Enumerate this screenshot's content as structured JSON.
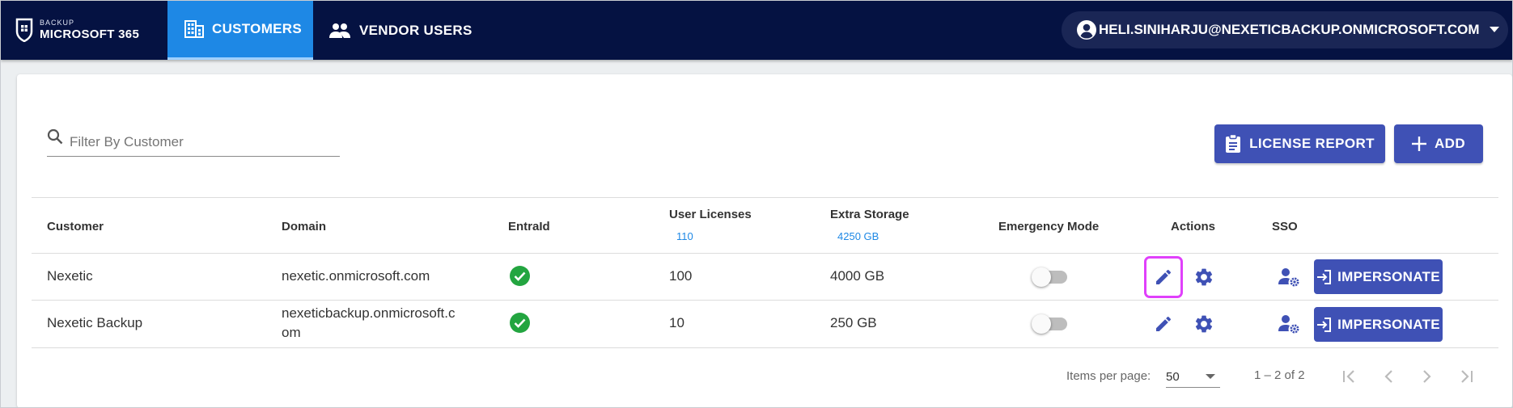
{
  "header": {
    "logo": {
      "small": "BACKUP",
      "big": "MICROSOFT 365"
    },
    "tabs": [
      {
        "label": "CUSTOMERS",
        "icon": "building-icon",
        "active": true
      },
      {
        "label": "VENDOR USERS",
        "icon": "people-icon",
        "active": false
      }
    ],
    "user_email": "HELI.SINIHARJU@NEXETICBACKUP.ONMICROSOFT.COM"
  },
  "toolbar": {
    "filter_placeholder": "Filter By Customer",
    "license_report_label": "LICENSE REPORT",
    "add_label": "ADD"
  },
  "table": {
    "columns": {
      "customer": "Customer",
      "domain": "Domain",
      "entraid": "EntraId",
      "user_licenses": "User Licenses",
      "user_licenses_total": "110",
      "extra_storage": "Extra Storage",
      "extra_storage_total": "4250 GB",
      "emergency_mode": "Emergency Mode",
      "actions": "Actions",
      "sso": "SSO"
    },
    "rows": [
      {
        "customer": "Nexetic",
        "domain_line1": "nexetic.onmicrosoft.com",
        "domain_line2": "",
        "entraid": true,
        "user_licenses": "100",
        "extra_storage": "4000 GB",
        "emergency_mode": false,
        "impersonate_label": "IMPERSONATE"
      },
      {
        "customer": "Nexetic Backup",
        "domain_line1": "nexeticbackup.onmicrosoft.c",
        "domain_line2": "om",
        "entraid": true,
        "user_licenses": "10",
        "extra_storage": "250 GB",
        "emergency_mode": false,
        "impersonate_label": "IMPERSONATE"
      }
    ]
  },
  "paginator": {
    "items_per_page_label": "Items per page:",
    "items_per_page_value": "50",
    "range_label": "1 – 2 of 2"
  },
  "colors": {
    "navbar": "#051242",
    "active_tab": "#1e88e5",
    "primary_button": "#3f51b5",
    "success": "#23a540",
    "focus_ring": "#e040fb"
  }
}
